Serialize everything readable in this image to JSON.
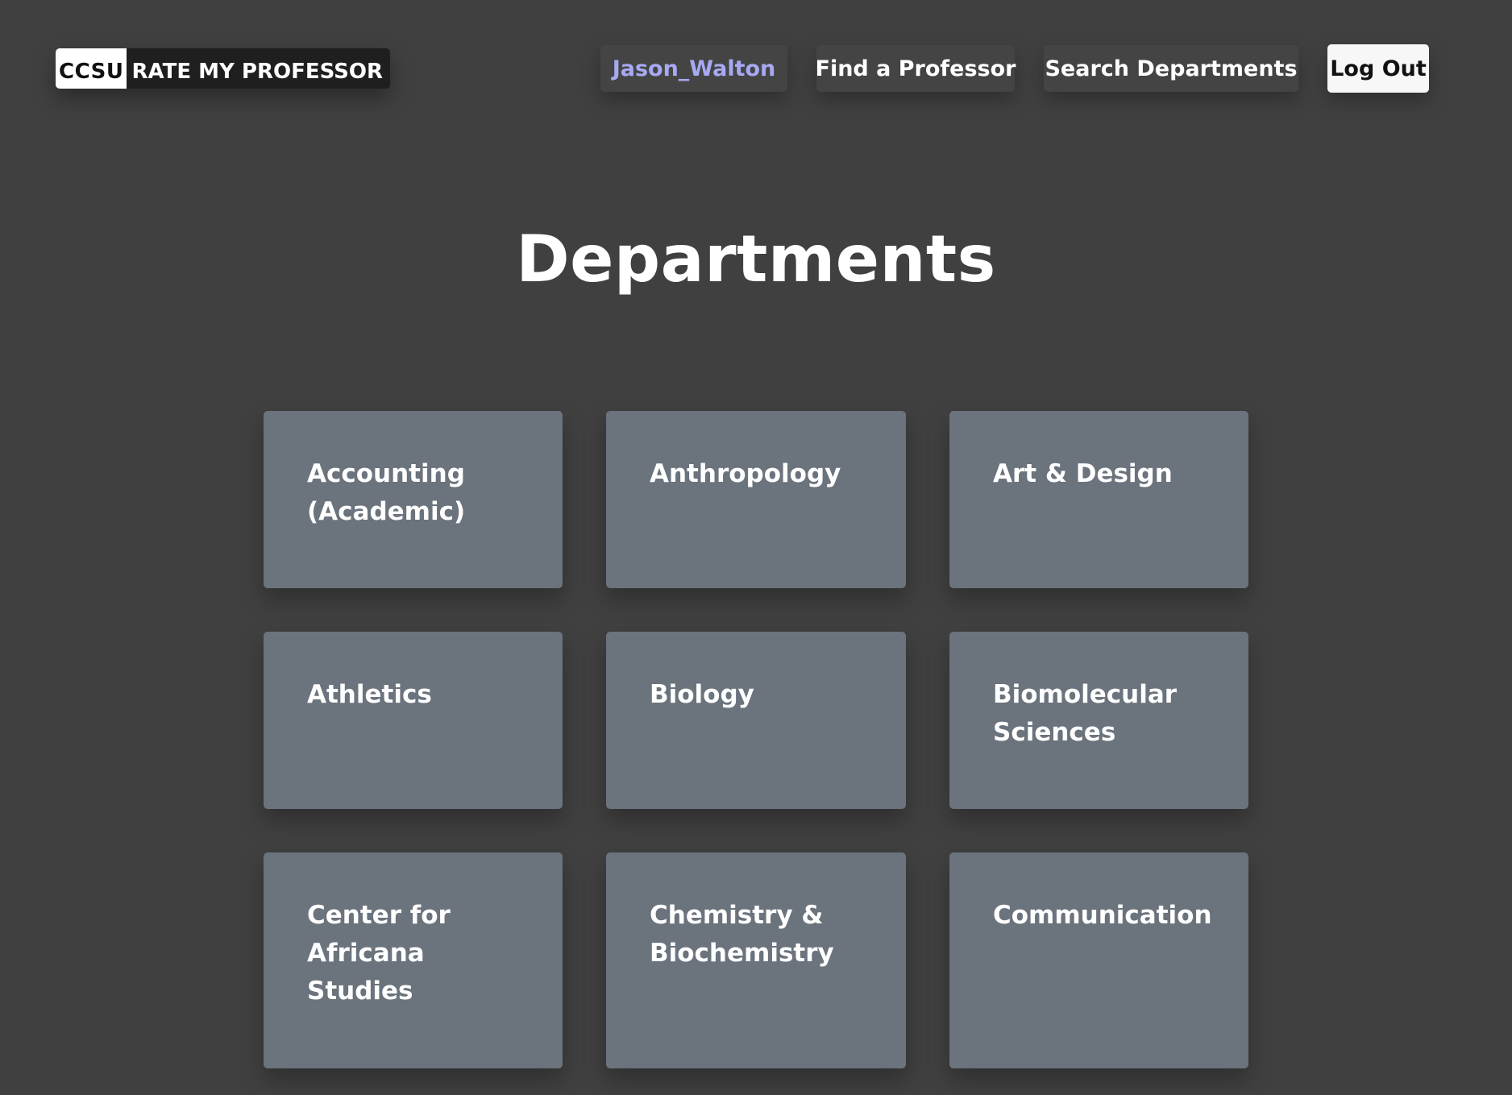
{
  "logo": {
    "ccsu": "CCSU",
    "text": "RATE MY PROFESSOR"
  },
  "nav": {
    "user": "Jason_Walton",
    "find_professor": "Find a Professor",
    "search_departments": "Search Departments",
    "logout": "Log Out"
  },
  "page": {
    "title": "Departments"
  },
  "departments": [
    "Accounting (Academic)",
    "Anthropology",
    "Art & Design",
    "Athletics",
    "Biology",
    "Biomolecular Sciences",
    "Center for Africana Studies",
    "Chemistry & Biochemistry",
    "Communication"
  ],
  "colors": {
    "background": "#404040",
    "card": "#6b737d",
    "username": "#a7a9f2",
    "logout_bg": "#f7f7f7"
  }
}
